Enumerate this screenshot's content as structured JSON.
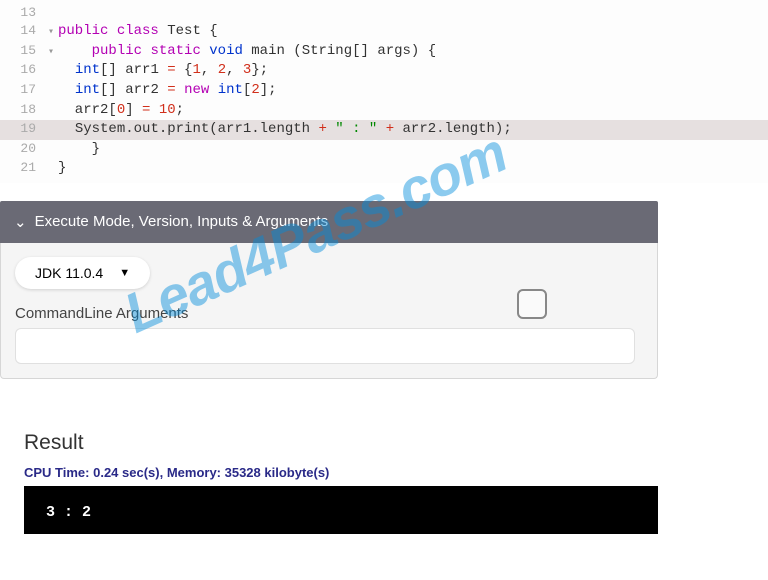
{
  "code": {
    "lines": [
      {
        "num": "13",
        "fold": "",
        "content": ""
      },
      {
        "num": "14",
        "fold": "▾",
        "content": "<span class='kw'>public</span> <span class='kw'>class</span> <span class='cls'>Test</span> {"
      },
      {
        "num": "15",
        "fold": "▾",
        "content": "    <span class='kw'>public</span> <span class='kw'>static</span> <span class='kw2'>void</span> <span class='cls'>main</span> (<span class='cls'>String</span>[] args) {"
      },
      {
        "num": "16",
        "fold": "",
        "content": "  <span class='kw2'>int</span>[] arr1 <span class='op'>=</span> {<span class='num'>1</span>, <span class='num'>2</span>, <span class='num'>3</span>};"
      },
      {
        "num": "17",
        "fold": "",
        "content": "  <span class='kw2'>int</span>[] arr2 <span class='op'>=</span> <span class='kw'>new</span> <span class='kw2'>int</span>[<span class='num'>2</span>];"
      },
      {
        "num": "18",
        "fold": "",
        "content": "  arr2[<span class='num'>0</span>] <span class='op'>=</span> <span class='num'>10</span>;"
      },
      {
        "num": "19",
        "fold": "",
        "highlight": true,
        "content": "  <span class='cls'>System</span>.out.print(arr1.length <span class='op'>+</span> <span class='str'>\" : \"</span> <span class='op'>+</span> arr2.length);"
      },
      {
        "num": "20",
        "fold": "",
        "content": "    }"
      },
      {
        "num": "21",
        "fold": "",
        "content": "}"
      }
    ]
  },
  "panel": {
    "title": "Execute Mode, Version, Inputs & Arguments",
    "version": "JDK 11.0.4",
    "args_label": "CommandLine Arguments",
    "args_value": ""
  },
  "result": {
    "heading": "Result",
    "stats": "CPU Time: 0.24 sec(s), Memory: 35328 kilobyte(s)",
    "output": "3 : 2"
  },
  "watermark": "Lead4Pass.com"
}
